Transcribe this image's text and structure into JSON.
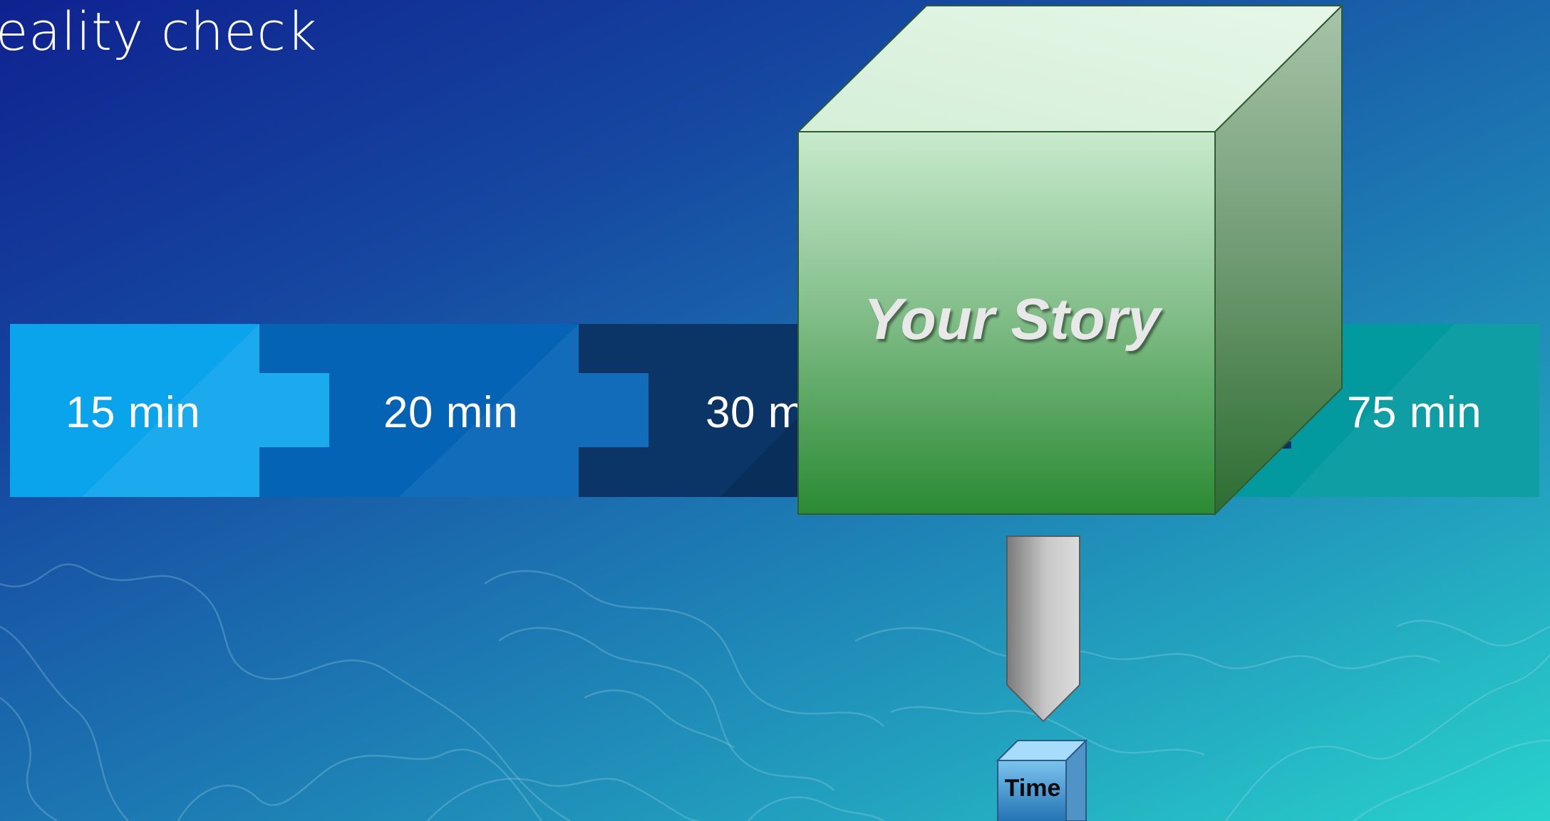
{
  "slide": {
    "title": "eality check"
  },
  "timeline": {
    "segments": [
      {
        "label": "15 min",
        "color": "#0aa4ec"
      },
      {
        "label": "20 min",
        "color": "#0563b5"
      },
      {
        "label": "30 min",
        "color": "#0a3566"
      },
      {
        "label": "75 min",
        "color": "#02999f"
      }
    ]
  },
  "diagram": {
    "story_label": "Your Story",
    "time_label": "Time",
    "cube_colors": {
      "front_top": "#c3e6c9",
      "front_bottom": "#2a8a33",
      "top": "#dcf4df",
      "side": "#7aa87f"
    }
  }
}
